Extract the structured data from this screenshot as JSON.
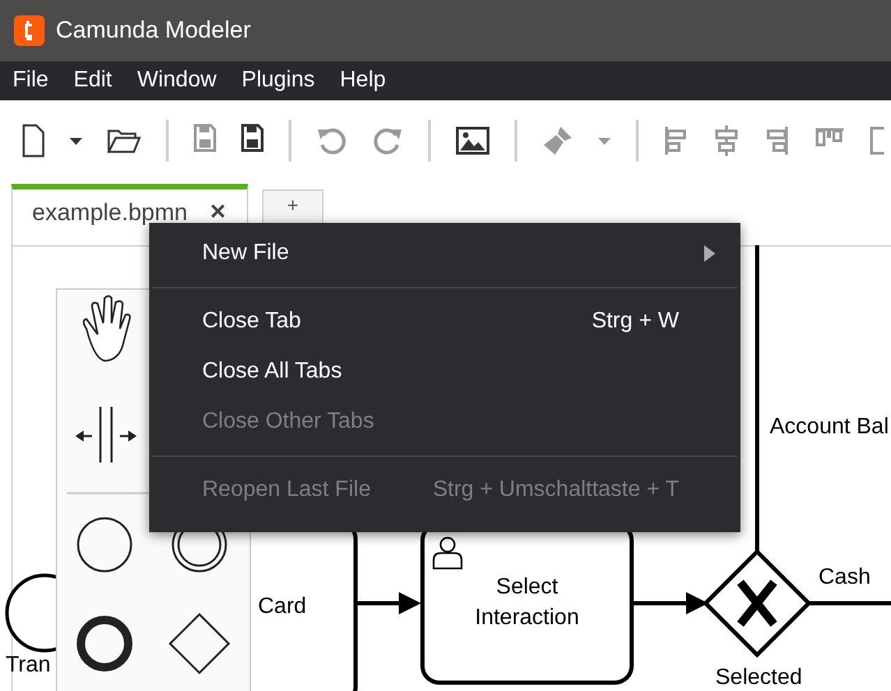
{
  "window": {
    "title": "Camunda Modeler"
  },
  "menubar": [
    "File",
    "Edit",
    "Window",
    "Plugins",
    "Help"
  ],
  "tabs": [
    {
      "label": "example.bpmn",
      "close": "✕",
      "selected": true
    },
    {
      "label": "+",
      "selected": false
    }
  ],
  "context_menu": [
    {
      "kind": "item",
      "label": "New File",
      "submenu": true,
      "disabled": false
    },
    {
      "kind": "separator"
    },
    {
      "kind": "item",
      "label": "Close Tab",
      "shortcut": "Strg + W",
      "disabled": false
    },
    {
      "kind": "item",
      "label": "Close All Tabs",
      "disabled": false
    },
    {
      "kind": "item",
      "label": "Close Other Tabs",
      "disabled": true
    },
    {
      "kind": "separator"
    },
    {
      "kind": "item",
      "label": "Reopen Last File",
      "shortcut": "Strg + Umschalttaste + T",
      "disabled": true
    }
  ],
  "diagram": {
    "start_event_label": "Tran",
    "tasks": [
      "Card",
      "Select Interaction"
    ],
    "gateway_label": "Selected",
    "flow_labels": [
      "Account Bal",
      "Cash"
    ]
  }
}
